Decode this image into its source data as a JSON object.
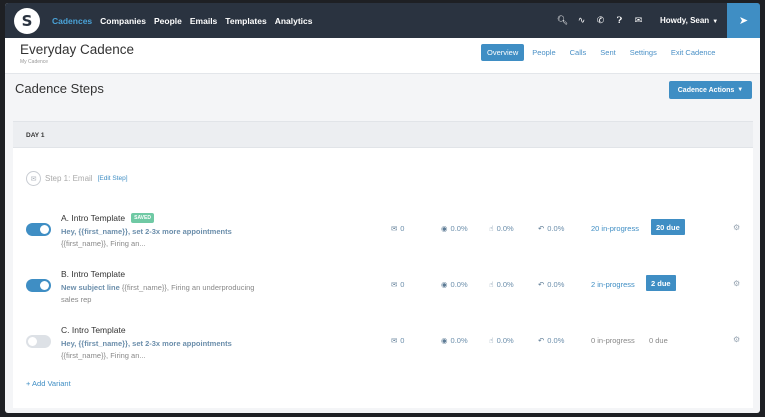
{
  "nav": {
    "logo_letter": "S",
    "links": [
      "Cadences",
      "Companies",
      "People",
      "Emails",
      "Templates",
      "Analytics"
    ],
    "icons": [
      "search-icon",
      "pulse-icon",
      "phone-icon",
      "help-icon",
      "inbox-icon"
    ],
    "user_greeting": "Howdy, Sean",
    "launch_icon": "rocket-icon"
  },
  "subheader": {
    "title": "Everyday Cadence",
    "subtitle": "My Cadence",
    "tabs": [
      "Overview",
      "People",
      "Calls",
      "Sent",
      "Settings",
      "Exit Cadence"
    ]
  },
  "page": {
    "title": "Cadence Steps",
    "actions_label": "Cadence Actions"
  },
  "day": {
    "label": "DAY 1"
  },
  "step": {
    "label": "Step 1: Email",
    "edit_label": "[Edit Step]"
  },
  "variants": [
    {
      "name": "A. Intro Template",
      "badge": "SAVED",
      "desc_bold": "Hey, {{first_name}}, set 2-3x more appointments",
      "desc_rest": " {{first_name}}, Firing an...",
      "enabled": true,
      "sent": "0",
      "views": "0.0%",
      "clicks": "0.0%",
      "replies": "0.0%",
      "in_progress": "20 in-progress",
      "due": "20 due"
    },
    {
      "name": "B. Intro Template",
      "badge": "",
      "desc_bold": "New subject line",
      "desc_rest": " {{first_name}}, Firing an underproducing sales rep",
      "enabled": true,
      "sent": "0",
      "views": "0.0%",
      "clicks": "0.0%",
      "replies": "0.0%",
      "in_progress": "2 in-progress",
      "due": "2 due"
    },
    {
      "name": "C. Intro Template",
      "badge": "",
      "desc_bold": "Hey, {{first_name}}, set 2-3x more appointments",
      "desc_rest": " {{first_name}}, Firing an...",
      "enabled": false,
      "sent": "0",
      "views": "0.0%",
      "clicks": "0.0%",
      "replies": "0.0%",
      "in_progress": "0 in-progress",
      "due": "0 due"
    }
  ],
  "add_variant_label": "+ Add Variant",
  "colors": {
    "nav_bg": "#2a3340",
    "accent": "#3f8ec4",
    "saved": "#6fc9a4"
  }
}
